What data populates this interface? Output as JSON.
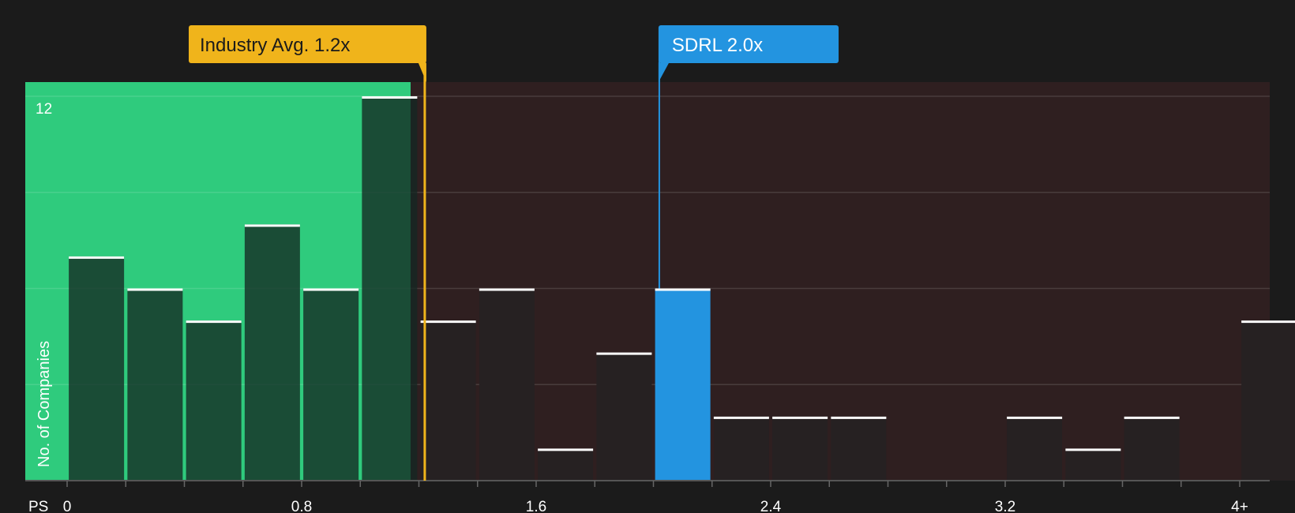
{
  "chart_data": {
    "type": "bar",
    "xlabel": "PS",
    "ylabel": "No. of Companies",
    "x_ticks": [
      "0",
      "0.8",
      "1.6",
      "2.4",
      "3.2",
      "4+"
    ],
    "y_ticks": [
      "12"
    ],
    "ylim": [
      0,
      12
    ],
    "xlim": [
      0,
      4.0
    ],
    "bins": [
      {
        "x": 0.1,
        "value": 7
      },
      {
        "x": 0.3,
        "value": 6
      },
      {
        "x": 0.5,
        "value": 5
      },
      {
        "x": 0.7,
        "value": 8
      },
      {
        "x": 0.9,
        "value": 6
      },
      {
        "x": 1.1,
        "value": 12
      },
      {
        "x": 1.3,
        "value": 5
      },
      {
        "x": 1.5,
        "value": 6
      },
      {
        "x": 1.7,
        "value": 1
      },
      {
        "x": 1.9,
        "value": 4
      },
      {
        "x": 2.1,
        "value": 6
      },
      {
        "x": 2.3,
        "value": 2
      },
      {
        "x": 2.5,
        "value": 2
      },
      {
        "x": 2.7,
        "value": 2
      },
      {
        "x": 2.9,
        "value": 0
      },
      {
        "x": 3.1,
        "value": 0
      },
      {
        "x": 3.3,
        "value": 2
      },
      {
        "x": 3.5,
        "value": 1
      },
      {
        "x": 3.7,
        "value": 2
      },
      {
        "x": 3.9,
        "value": 0
      },
      {
        "x": 4.1,
        "value": 5
      }
    ],
    "industry_avg": {
      "label": "Industry Avg. 1.2x",
      "value": 1.22
    },
    "company": {
      "label": "SDRL 2.0x",
      "value": 2.02
    },
    "colors": {
      "background": "#1b1b1b",
      "below_zone": "#2fcb7d",
      "above_zone": "#2f1f20",
      "industry": "#f0b41b",
      "company": "#2394e0",
      "bar_dark": "#244a39",
      "bar_above": "#262122",
      "cap": "#ffffff"
    }
  }
}
